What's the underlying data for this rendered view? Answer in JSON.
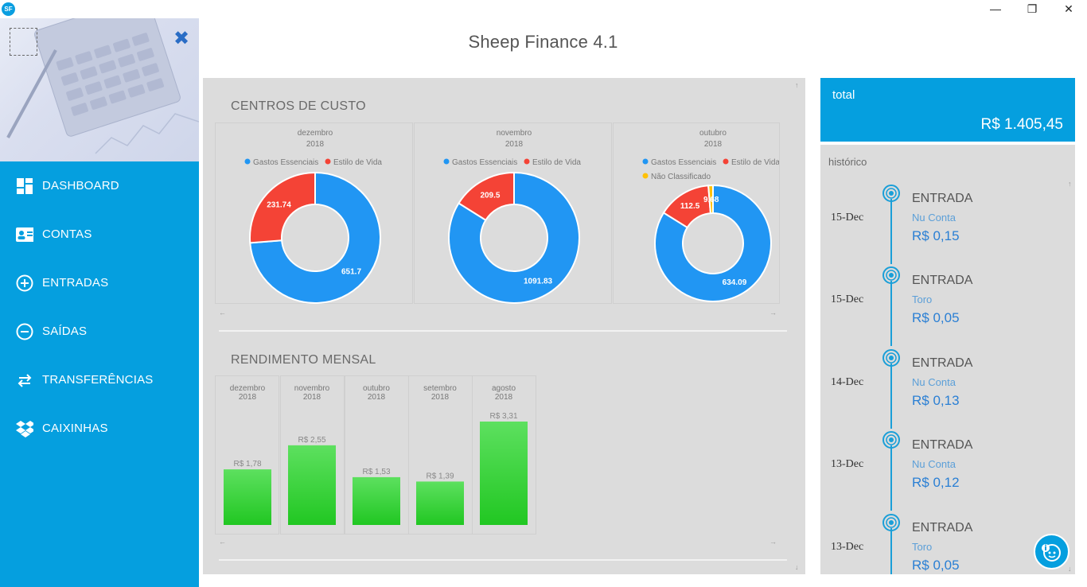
{
  "app": {
    "title": "Sheep Finance 4.1",
    "accent": "#059fdf"
  },
  "window_controls": {
    "minimize": "—",
    "maximize": "❐",
    "close": "✕"
  },
  "sidebar": {
    "items": [
      {
        "label": "DASHBOARD",
        "icon": "dashboard-icon"
      },
      {
        "label": "CONTAS",
        "icon": "contact-card-icon"
      },
      {
        "label": "ENTRADAS",
        "icon": "plus-circle-icon"
      },
      {
        "label": "SAÍDAS",
        "icon": "minus-circle-icon"
      },
      {
        "label": "TRANSFERÊNCIAS",
        "icon": "swap-arrows-icon"
      },
      {
        "label": "CAIXINHAS",
        "icon": "dropbox-icon"
      }
    ]
  },
  "centros": {
    "title": "CENTROS DE CUSTO",
    "legend": {
      "essential": "Gastos Essenciais",
      "lifestyle": "Estilo de Vida",
      "unclassified": "Não Classificado"
    },
    "months": [
      {
        "month": "dezembro",
        "year": "2018"
      },
      {
        "month": "novembro",
        "year": "2018"
      },
      {
        "month": "outubro",
        "year": "2018"
      }
    ]
  },
  "rendimento": {
    "title": "RENDIMENTO MENSAL",
    "months": [
      {
        "month": "dezembro",
        "year": "2018",
        "label": "R$ 1,78"
      },
      {
        "month": "novembro",
        "year": "2018",
        "label": "R$ 2,55"
      },
      {
        "month": "outubro",
        "year": "2018",
        "label": "R$ 1,53"
      },
      {
        "month": "setembro",
        "year": "2018",
        "label": "R$ 1,39"
      },
      {
        "month": "agosto",
        "year": "2018",
        "label": "R$ 3,31"
      }
    ]
  },
  "chart_data": [
    {
      "type": "pie",
      "subtitle": "dezembro 2018",
      "labels": [
        "Gastos Essenciais",
        "Estilo de Vida"
      ],
      "values": [
        651.7,
        231.74
      ],
      "colors": [
        "#2196f3",
        "#f44336"
      ]
    },
    {
      "type": "pie",
      "subtitle": "novembro 2018",
      "labels": [
        "Gastos Essenciais",
        "Estilo de Vida"
      ],
      "values": [
        1091.83,
        209.5
      ],
      "colors": [
        "#2196f3",
        "#f44336"
      ]
    },
    {
      "type": "pie",
      "subtitle": "outubro 2018",
      "labels": [
        "Gastos Essenciais",
        "Estilo de Vida",
        "Não Classificado"
      ],
      "values": [
        634.09,
        112.5,
        9.68
      ],
      "colors": [
        "#2196f3",
        "#f44336",
        "#ffc107"
      ]
    },
    {
      "type": "bar",
      "title": "RENDIMENTO MENSAL",
      "categories": [
        "dezembro 2018",
        "novembro 2018",
        "outubro 2018",
        "setembro 2018",
        "agosto 2018"
      ],
      "values": [
        1.78,
        2.55,
        1.53,
        1.39,
        3.31
      ],
      "ylim": [
        0,
        3.31
      ]
    }
  ],
  "total": {
    "label": "total",
    "value": "R$ 1.405,45"
  },
  "history": {
    "title": "histórico",
    "items": [
      {
        "date": "15-Dec",
        "type": "ENTRADA",
        "account": "Nu Conta",
        "amount": "R$ 0,15"
      },
      {
        "date": "15-Dec",
        "type": "ENTRADA",
        "account": "Toro",
        "amount": "R$ 0,05"
      },
      {
        "date": "14-Dec",
        "type": "ENTRADA",
        "account": "Nu Conta",
        "amount": "R$ 0,13"
      },
      {
        "date": "13-Dec",
        "type": "ENTRADA",
        "account": "Nu Conta",
        "amount": "R$ 0,12"
      },
      {
        "date": "13-Dec",
        "type": "ENTRADA",
        "account": "Toro",
        "amount": "R$ 0,05"
      }
    ]
  }
}
